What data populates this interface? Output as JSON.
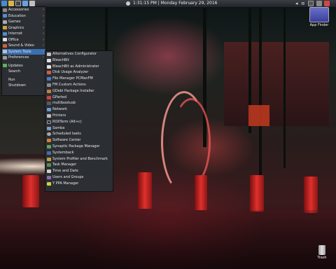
{
  "panel": {
    "clock": "1:31:15 PM | Monday February 29, 2016"
  },
  "main_menu": {
    "items": [
      {
        "label": "Accessories",
        "icon": "accessories-icon",
        "submenu": true
      },
      {
        "label": "Education",
        "icon": "education-icon",
        "submenu": true
      },
      {
        "label": "Games",
        "icon": "games-icon",
        "submenu": true
      },
      {
        "label": "Graphics",
        "icon": "graphics-icon",
        "submenu": true
      },
      {
        "label": "Internet",
        "icon": "internet-icon",
        "submenu": true
      },
      {
        "label": "Office",
        "icon": "office-icon",
        "submenu": true
      },
      {
        "label": "Sound & Video",
        "icon": "sound-video-icon",
        "submenu": true
      },
      {
        "label": "System Tools",
        "icon": "system-tools-icon",
        "submenu": true,
        "selected": true
      },
      {
        "label": "Preferences",
        "icon": "preferences-icon",
        "submenu": true
      },
      {
        "label": "Updates",
        "icon": "updates-icon"
      },
      {
        "label": "Search",
        "icon": "search-icon"
      },
      {
        "label": "Run",
        "icon": "run-icon"
      },
      {
        "label": "Shutdown",
        "icon": "shutdown-icon"
      }
    ]
  },
  "system_tools": {
    "items": [
      "Alternatives Configurator",
      "BleachBit",
      "BleachBit as Administrator",
      "Disk Usage Analyzer",
      "File Manager PCManFM",
      "FM Custom Actions",
      "GDebi Package Installer",
      "GParted",
      "multibootusb",
      "Network",
      "Printers",
      "ROXTerm (Alt+c)",
      "Samba",
      "Scheduled tasks",
      "Software Center",
      "Synaptic Package Manager",
      "Systemback",
      "System Profiler and Benchmark",
      "Task Manager",
      "Time and Date",
      "Users and Groups",
      "Y PPA Manager"
    ]
  },
  "desktop": {
    "app_finder": "App Finder",
    "trash": "Trash"
  },
  "colors": {
    "menu_bg": "#2b2e33",
    "selected": "#3a6fb0",
    "panel": "#2e3137"
  }
}
